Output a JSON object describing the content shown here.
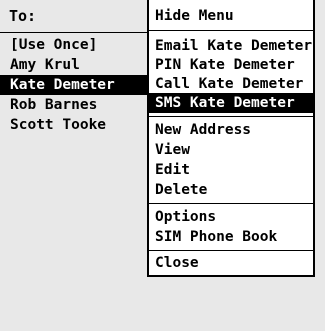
{
  "header": {
    "to_label": "To:"
  },
  "contacts": [
    {
      "label": "[Use Once]"
    },
    {
      "label": "Amy Krul"
    },
    {
      "label": "Kate Demeter"
    },
    {
      "label": "Rob Barnes"
    },
    {
      "label": "Scott Tooke"
    }
  ],
  "selected_contact": "Kate Demeter",
  "menu": {
    "items": [
      {
        "label": "Hide Menu"
      },
      {
        "label": "Email Kate Demeter"
      },
      {
        "label": "PIN Kate Demeter"
      },
      {
        "label": "Call Kate Demeter"
      },
      {
        "label": "SMS Kate Demeter"
      },
      {
        "label": "New Address"
      },
      {
        "label": "View"
      },
      {
        "label": "Edit"
      },
      {
        "label": "Delete"
      },
      {
        "label": "Options"
      },
      {
        "label": "SIM Phone Book"
      },
      {
        "label": "Close"
      }
    ],
    "selected_item": "SMS Kate Demeter"
  },
  "colors": {
    "selection_background": "#000000",
    "selection_text": "#ffffff",
    "screen_background": "#e8e8e8",
    "menu_background": "#ffffff"
  }
}
